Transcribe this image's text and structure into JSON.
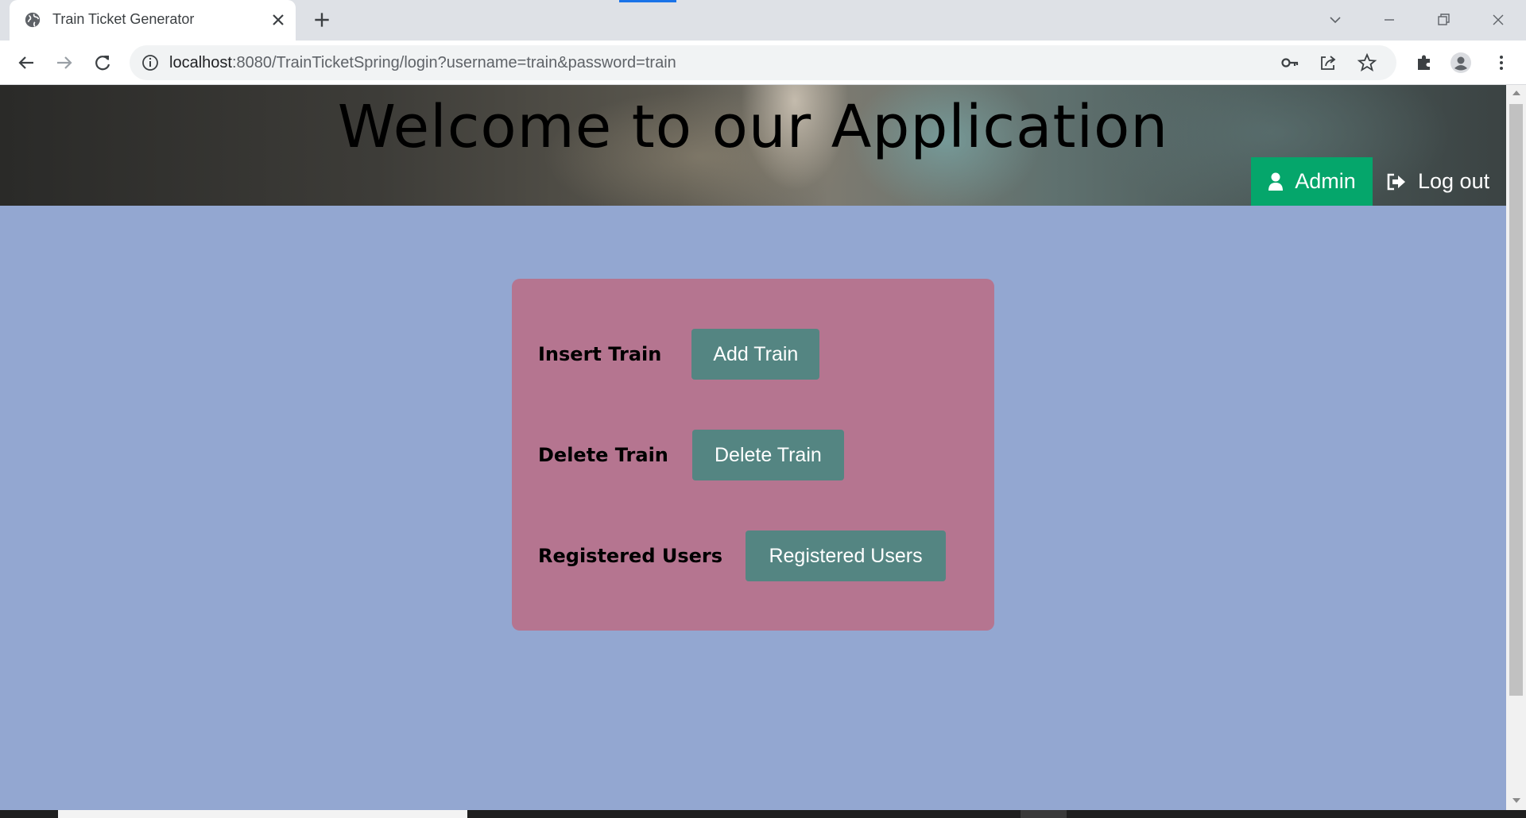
{
  "browser": {
    "tab_title": "Train Ticket Generator",
    "url_host": "localhost",
    "url_path": ":8080/TrainTicketSpring/login?username=train&password=train",
    "icons": [
      "globe-icon",
      "close-icon",
      "plus-icon",
      "back-arrow-icon",
      "forward-arrow-icon",
      "reload-icon",
      "info-icon",
      "key-icon",
      "share-icon",
      "star-icon",
      "puzzle-icon",
      "profile-icon",
      "kebab-menu-icon",
      "chevron-down-icon",
      "minimize-icon",
      "restore-icon",
      "window-close-icon"
    ]
  },
  "header": {
    "title": "Welcome to our Application",
    "admin_label": "Admin",
    "logout_label": "Log out"
  },
  "panel": {
    "rows": [
      {
        "label": "Insert Train",
        "button": "Add Train"
      },
      {
        "label": "Delete Train",
        "button": "Delete Train"
      },
      {
        "label": "Registered Users",
        "button": "Registered Users"
      }
    ]
  },
  "colors": {
    "page_bg": "#93a7d1",
    "panel_bg": "#b57590",
    "button_bg": "#548582",
    "admin_bg": "#05a66b"
  }
}
